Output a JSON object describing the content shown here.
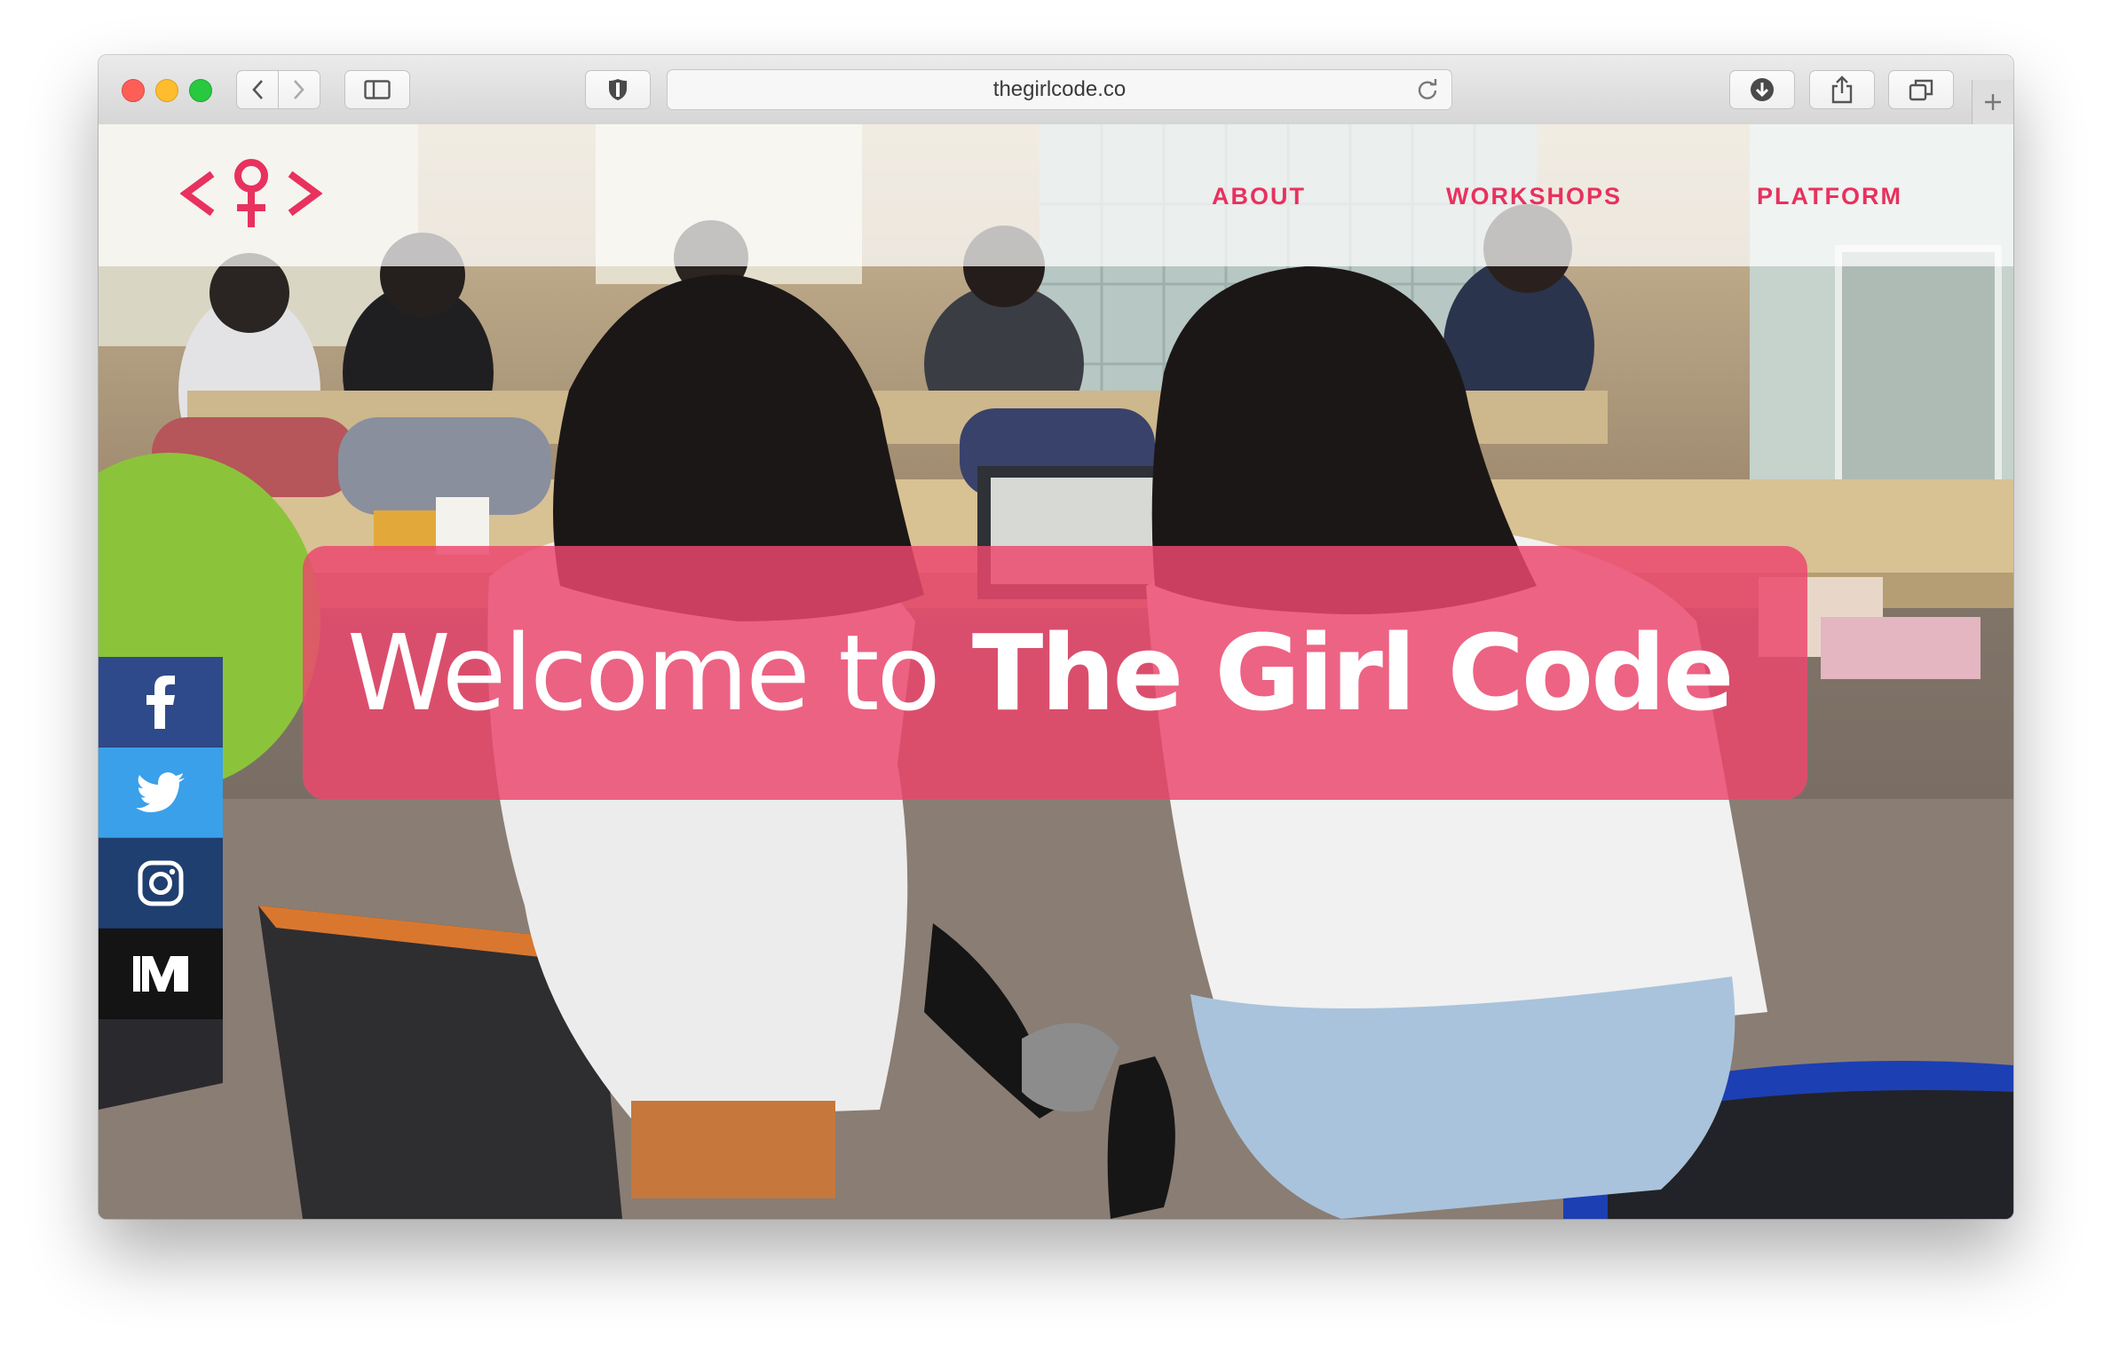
{
  "browser": {
    "url": "thegirlcode.co"
  },
  "site": {
    "nav": {
      "about": "ABOUT",
      "workshops": "WORKSHOPS",
      "platform": "PLATFORM"
    },
    "hero": {
      "title_light": "Welcome to",
      "title_bold": "The Girl Code"
    },
    "social": [
      "facebook-icon",
      "twitter-icon",
      "instagram-icon",
      "medium-icon"
    ]
  },
  "colors": {
    "brand_pink": "#e8315e",
    "banner_pink": "#ec486e",
    "facebook": "#2f4a8a",
    "twitter": "#3aa0ea",
    "instagram": "#1f3f70",
    "medium": "#141414"
  }
}
